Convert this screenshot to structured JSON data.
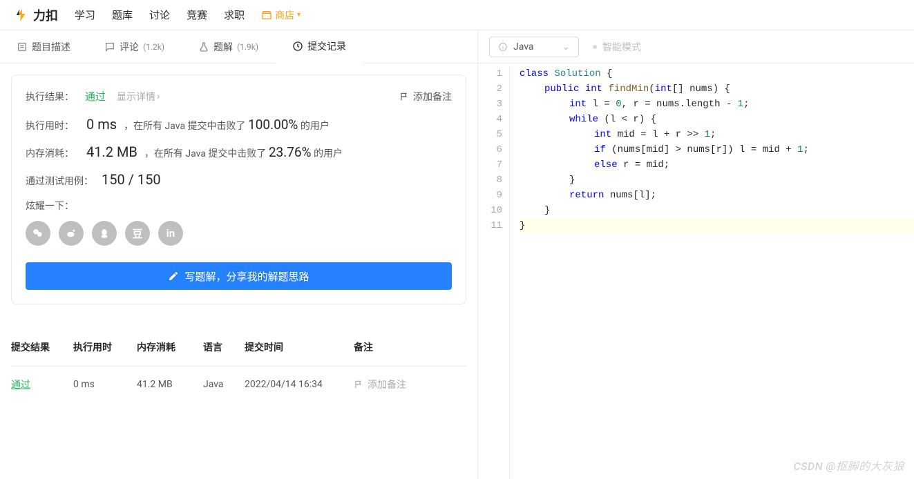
{
  "nav": {
    "brand": "力扣",
    "links": [
      "学习",
      "题库",
      "讨论",
      "竞赛",
      "求职"
    ],
    "shop": "商店"
  },
  "tabs": [
    {
      "icon": "description",
      "label": "题目描述",
      "count": ""
    },
    {
      "icon": "comment",
      "label": "评论",
      "count": "(1.2k)"
    },
    {
      "icon": "flask",
      "label": "题解",
      "count": "(1.9k)"
    },
    {
      "icon": "history",
      "label": "提交记录",
      "count": "",
      "active": true
    }
  ],
  "submission": {
    "result_label": "执行结果：",
    "status": "通过",
    "show_detail": "显示详情",
    "add_note": "添加备注",
    "runtime_label": "执行用时：",
    "runtime_value": "0 ms",
    "beats_prefix": "，在所有 Java 提交中击败了",
    "runtime_percent": "100.00%",
    "beats_suffix": "的用户",
    "memory_label": "内存消耗：",
    "memory_value": "41.2 MB",
    "memory_percent": "23.76%",
    "cases_label": "通过测试用例：",
    "cases_value": "150 / 150",
    "share_label": "炫耀一下：",
    "write_button": "写题解，分享我的解题思路"
  },
  "history": {
    "headers": [
      "提交结果",
      "执行用时",
      "内存消耗",
      "语言",
      "提交时间",
      "备注"
    ],
    "rows": [
      {
        "status": "通过",
        "time": "0 ms",
        "mem": "41.2 MB",
        "lang": "Java",
        "submit": "2022/04/14 16:34",
        "note": "添加备注"
      }
    ]
  },
  "editor": {
    "language": "Java",
    "smart_mode": "智能模式",
    "code_lines": [
      {
        "n": 1,
        "html": "<span class='kw'>class</span> <span class='type'>Solution</span> {"
      },
      {
        "n": 2,
        "html": "<span class='indent1'><span class='kw'>public</span> <span class='kw'>int</span> <span class='name'>findMin</span>(<span class='kw'>int</span>[] nums) {</span>"
      },
      {
        "n": 3,
        "html": "<span class='indent2'><span class='kw'>int</span> l = <span class='num'>0</span>, r = nums.length - <span class='num'>1</span>;</span>"
      },
      {
        "n": 4,
        "html": "<span class='indent2'><span class='kw'>while</span> (l &lt; r) {</span>"
      },
      {
        "n": 5,
        "html": "<span class='indent3'><span class='kw'>int</span> mid = l + r &gt;&gt; <span class='num'>1</span>;</span>"
      },
      {
        "n": 6,
        "html": "<span class='indent3'><span class='kw'>if</span> (nums[mid] &gt; nums[r]) l = mid + <span class='num'>1</span>;</span>"
      },
      {
        "n": 7,
        "html": "<span class='indent3'><span class='kw'>else</span> r = mid;</span>"
      },
      {
        "n": 8,
        "html": "<span class='indent2'>}</span>"
      },
      {
        "n": 9,
        "html": "<span class='indent2'><span class='kw'>return</span> nums[l];</span>"
      },
      {
        "n": 10,
        "html": "<span class='indent1'>}<span>"
      },
      {
        "n": 11,
        "html": "}"
      }
    ]
  },
  "watermark": "CSDN @抠脚的大灰狼"
}
